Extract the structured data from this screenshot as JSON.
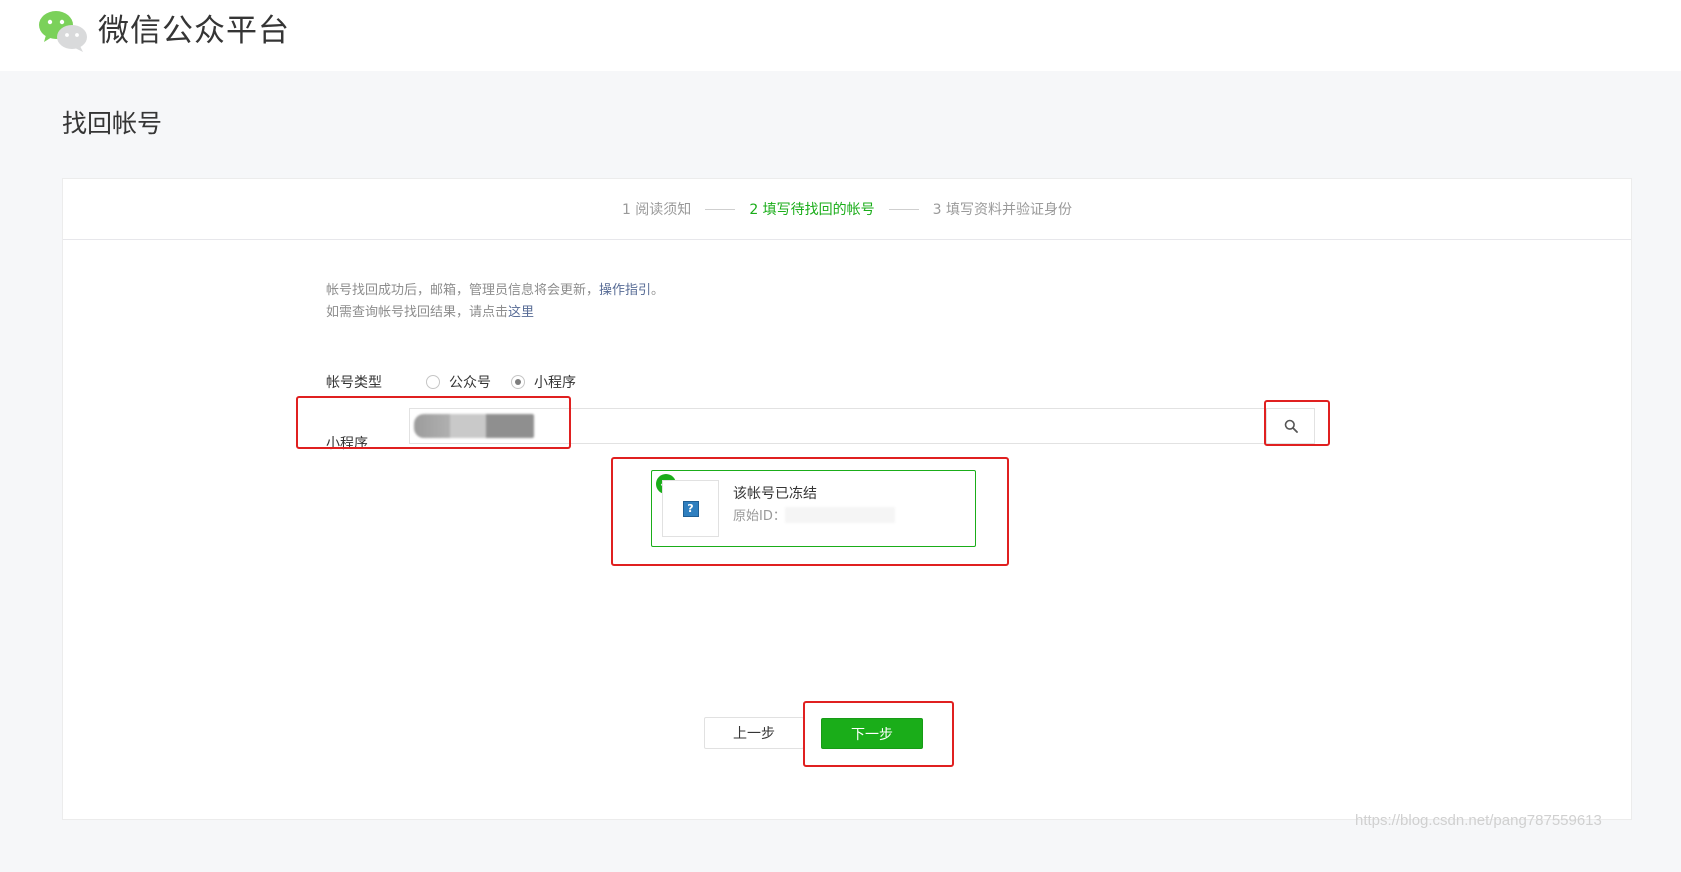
{
  "header": {
    "brand": "微信公众平台"
  },
  "page": {
    "title": "找回帐号"
  },
  "steps": [
    {
      "label": "1 阅读须知",
      "active": false
    },
    {
      "label": "2 填写待找回的帐号",
      "active": true
    },
    {
      "label": "3 填写资料并验证身份",
      "active": false
    }
  ],
  "notice": {
    "line1_text": "帐号找回成功后，邮箱，管理员信息将会更新，",
    "line1_link": "操作指引",
    "line1_end": "。",
    "line2_text": "如需查询帐号找回结果，请点击",
    "line2_link": "这里"
  },
  "account_type": {
    "label": "帐号类型",
    "options": [
      {
        "label": "公众号",
        "selected": false
      },
      {
        "label": "小程序",
        "selected": true
      }
    ]
  },
  "search": {
    "label": "小程序",
    "icon": "search-icon"
  },
  "result": {
    "status": "该帐号已冻结",
    "id_label": "原始ID："
  },
  "actions": {
    "prev_label": "上一步",
    "next_label": "下一步"
  },
  "watermark": "https://blog.csdn.net/pang787559613",
  "colors": {
    "accent": "#1aad19",
    "link": "#576b95",
    "highlight": "#e02020"
  }
}
